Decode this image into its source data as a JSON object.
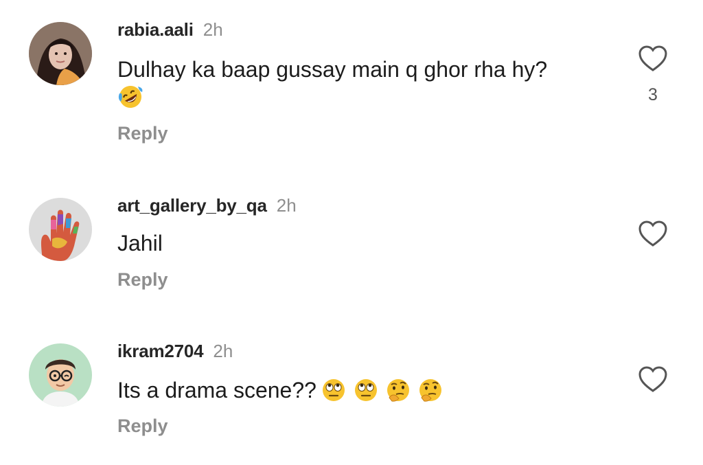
{
  "comments": [
    {
      "username": "rabia.aali",
      "time": "2h",
      "text": "Dulhay ka baap gussay main q ghor rha hy?",
      "emojis": [
        "rolling-on-floor-laughing"
      ],
      "reply_label": "Reply",
      "like_count": "3",
      "avatar": "woman-portrait"
    },
    {
      "username": "art_gallery_by_qa",
      "time": "2h",
      "text": "Jahil",
      "emojis": [],
      "reply_label": "Reply",
      "like_count": "",
      "avatar": "painted-hand"
    },
    {
      "username": "ikram2704",
      "time": "2h",
      "text": "Its a drama scene??",
      "emojis": [
        "face-with-rolling-eyes",
        "face-with-rolling-eyes",
        "thinking-face",
        "thinking-face"
      ],
      "reply_label": "Reply",
      "like_count": "",
      "avatar": "cartoon-man-with-glasses"
    }
  ],
  "colors": {
    "username": "#262626",
    "muted": "#8e8e8e",
    "text": "#1c1c1c",
    "heart_outline": "#555555"
  },
  "icons": {
    "like": "heart-outline-icon"
  }
}
